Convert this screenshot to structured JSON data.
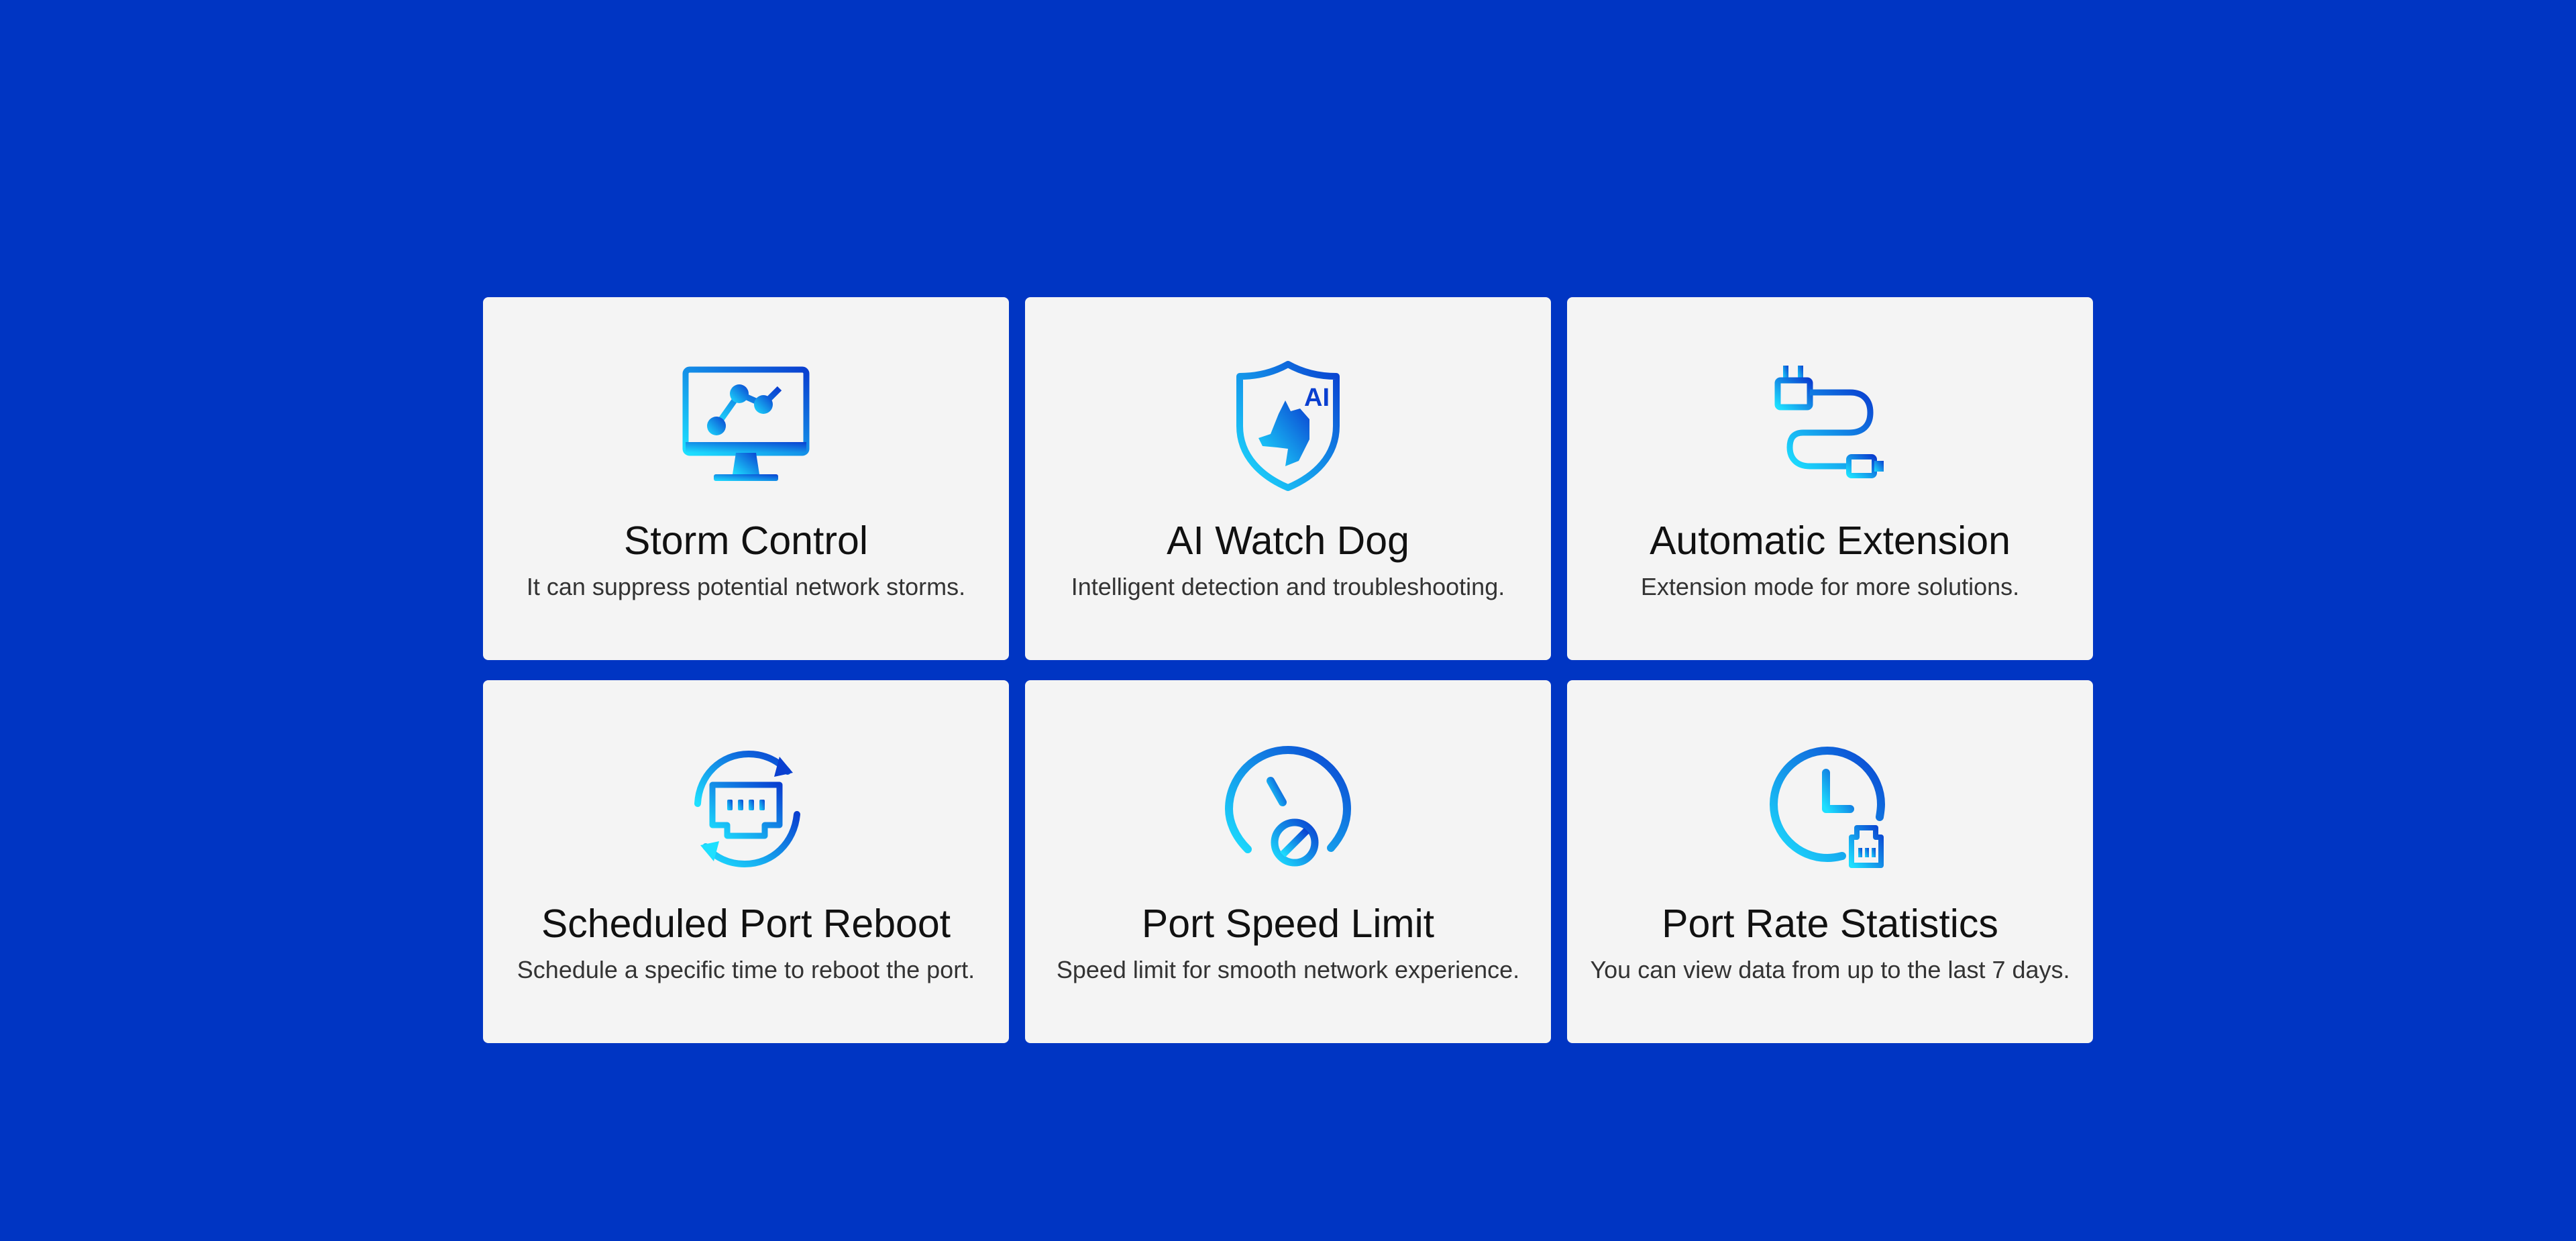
{
  "colors": {
    "background": "#0035c3",
    "card": "#f4f4f4",
    "icon_gradient_start": "#1de0ff",
    "icon_gradient_end": "#0a3fd0",
    "title_text": "#111111",
    "desc_text": "#333333"
  },
  "features": [
    {
      "icon": "monitor-network-graph-icon",
      "title": "Storm Control",
      "description": "It can suppress potential network storms."
    },
    {
      "icon": "shield-dog-ai-icon",
      "title": "AI Watch Dog",
      "description": "Intelligent detection and troubleshooting.",
      "icon_badge": "AI"
    },
    {
      "icon": "plug-cable-icon",
      "title": "Automatic Extension",
      "description": "Extension mode for more solutions."
    },
    {
      "icon": "port-refresh-icon",
      "title": "Scheduled Port Reboot",
      "description": "Schedule a specific time to reboot the port."
    },
    {
      "icon": "speed-gauge-limit-icon",
      "title": "Port Speed Limit",
      "description": "Speed limit for smooth network experience."
    },
    {
      "icon": "clock-port-icon",
      "title": "Port Rate Statistics",
      "description": "You can view data from up to the last 7 days."
    }
  ]
}
